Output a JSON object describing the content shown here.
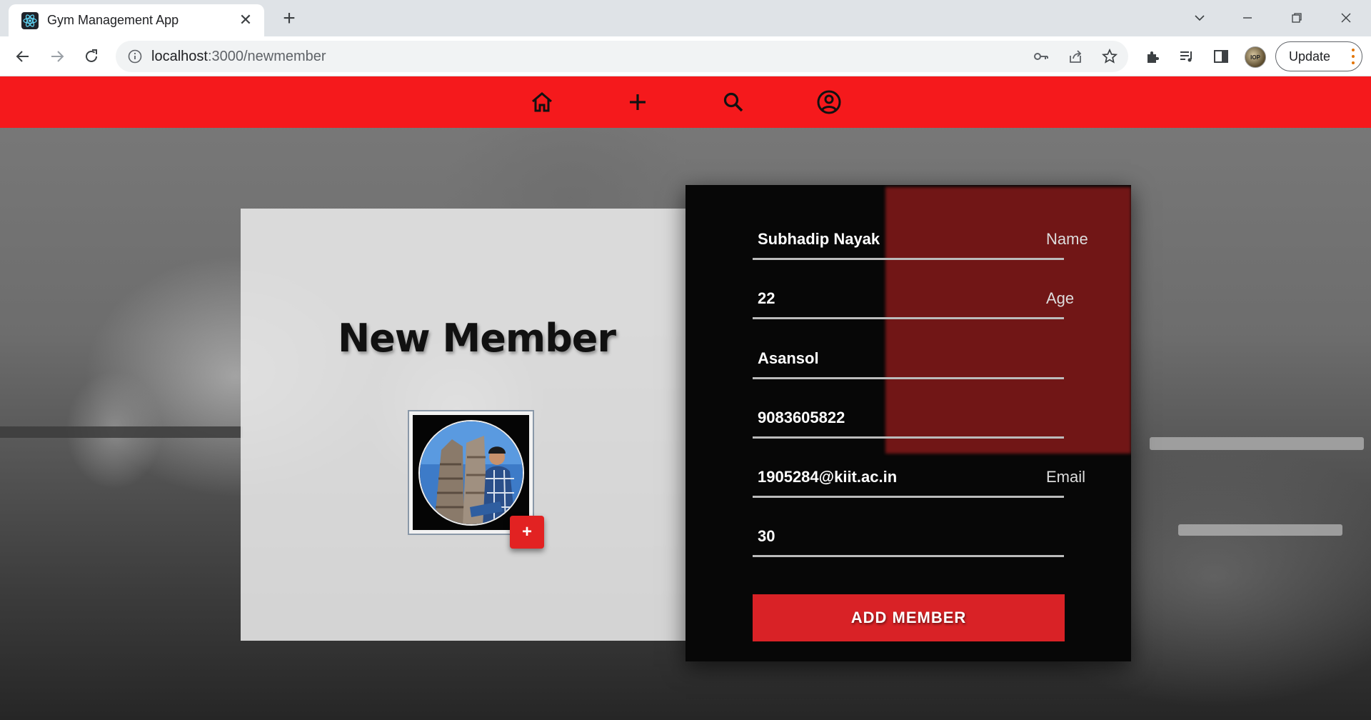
{
  "browser": {
    "tab_title": "Gym Management App",
    "url_host": "localhost",
    "url_rest": ":3000/newmember",
    "update_label": "Update",
    "avatar_text": "IOP"
  },
  "navbar": {
    "icons": [
      "home-icon",
      "plus-icon",
      "search-icon",
      "account-icon"
    ]
  },
  "left_panel": {
    "title": "New Member",
    "add_photo_label": "+"
  },
  "form": {
    "name": {
      "value": "Subhadip Nayak",
      "label": "Name"
    },
    "age": {
      "value": "22",
      "label": "Age"
    },
    "address": {
      "value": "Asansol",
      "label": ""
    },
    "phone": {
      "value": "9083605822",
      "label": ""
    },
    "email": {
      "value": "1905284@kiit.ac.in",
      "label": "Email"
    },
    "duration": {
      "value": "30",
      "label": ""
    },
    "submit_label": "ADD MEMBER"
  },
  "colors": {
    "navbar": "#f5191c",
    "button": "#d92226",
    "form_bg": "#070707"
  }
}
